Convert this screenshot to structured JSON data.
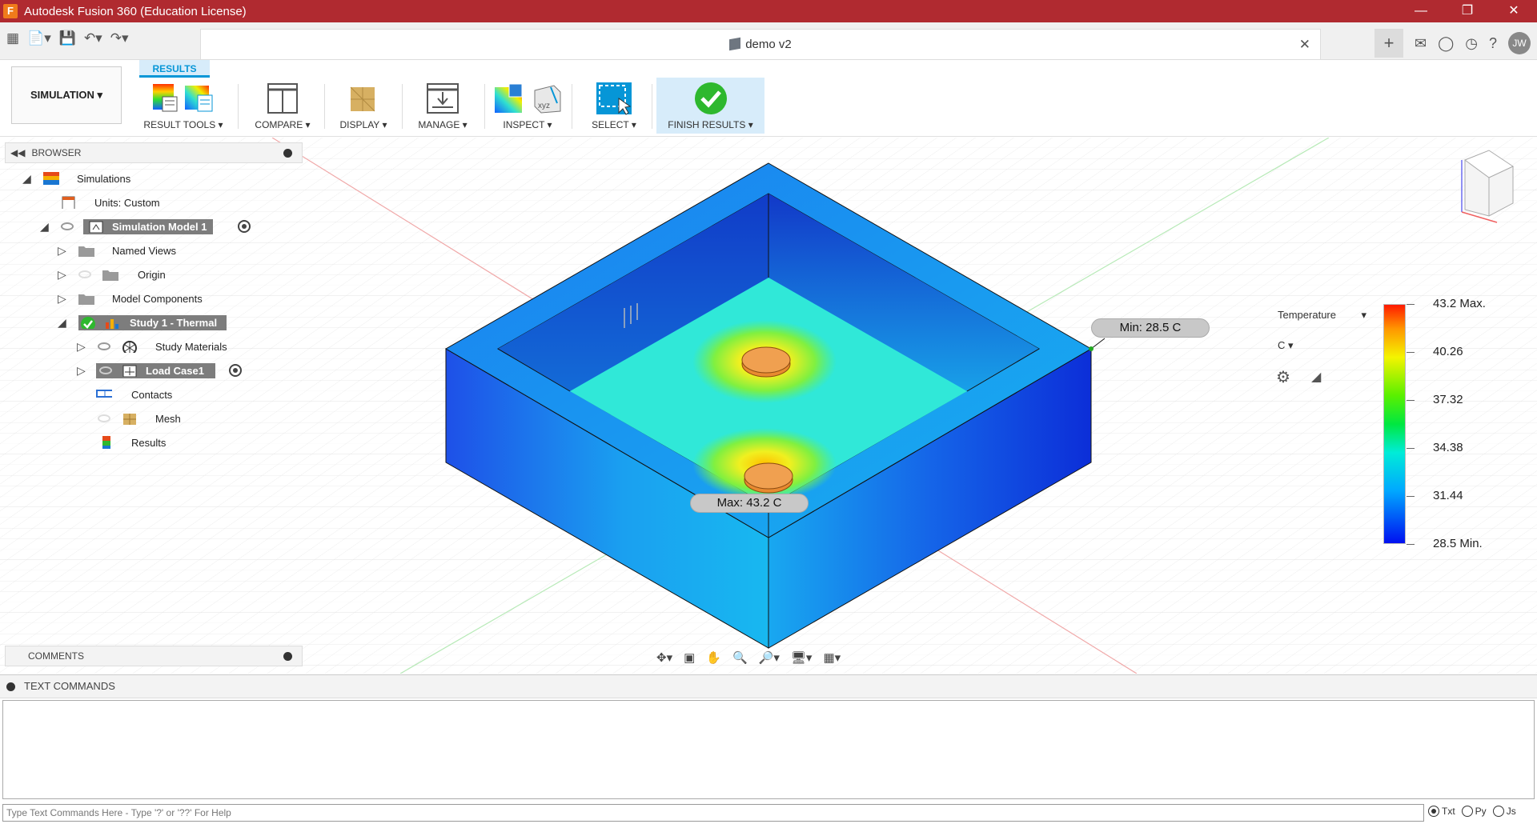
{
  "window": {
    "title": "Autodesk Fusion 360 (Education License)",
    "app_icon_letter": "F"
  },
  "document": {
    "title": "demo v2"
  },
  "user": {
    "initials": "JW"
  },
  "toolbar": {
    "workspace": "SIMULATION",
    "active_tab": "RESULTS",
    "groups": [
      {
        "label": "RESULT TOOLS"
      },
      {
        "label": "COMPARE"
      },
      {
        "label": "DISPLAY"
      },
      {
        "label": "MANAGE"
      },
      {
        "label": "INSPECT"
      },
      {
        "label": "SELECT"
      },
      {
        "label": "FINISH RESULTS"
      }
    ]
  },
  "browser": {
    "title": "BROWSER",
    "items": [
      {
        "label": "Simulations"
      },
      {
        "label": "Units: Custom"
      },
      {
        "label": "Simulation Model 1"
      },
      {
        "label": "Named Views"
      },
      {
        "label": "Origin"
      },
      {
        "label": "Model Components"
      },
      {
        "label": "Study 1 - Thermal"
      },
      {
        "label": "Study Materials"
      },
      {
        "label": "Load Case1"
      },
      {
        "label": "Contacts"
      },
      {
        "label": "Mesh"
      },
      {
        "label": "Results"
      }
    ]
  },
  "comments": {
    "title": "COMMENTS"
  },
  "legend": {
    "result_type": "Temperature",
    "unit": "C",
    "labels": [
      "43.2 Max.",
      "40.26",
      "37.32",
      "34.38",
      "31.44",
      "28.5 Min."
    ]
  },
  "callouts": {
    "min": "Min: 28.5 C",
    "max": "Max: 43.2 C"
  },
  "text_commands": {
    "title": "TEXT COMMANDS",
    "placeholder": "Type Text Commands Here - Type '?' or '??' For Help",
    "modes": [
      "Txt",
      "Py",
      "Js"
    ],
    "selected_mode": "Txt"
  },
  "colors": {
    "titlebar": "#b02a30",
    "accent": "#0696d7",
    "highlight": "#7d7d7d"
  }
}
